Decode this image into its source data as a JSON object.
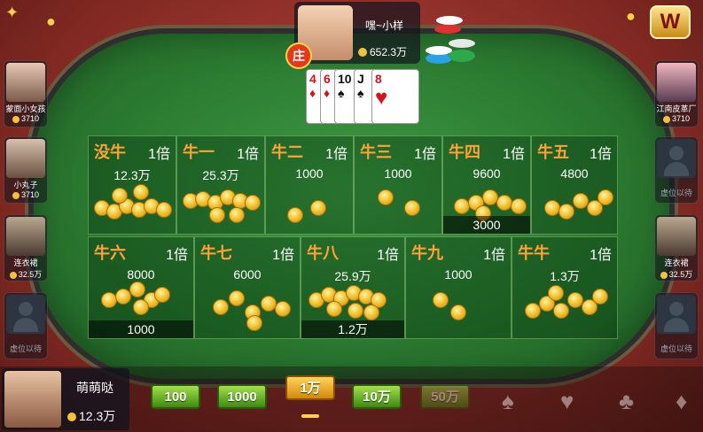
{
  "banker": {
    "name": "嘿~小样",
    "money": "652.3万",
    "badge": "庄"
  },
  "logo": "W",
  "cards": [
    {
      "rank": "4",
      "suit": "♦",
      "color": "red"
    },
    {
      "rank": "6",
      "suit": "♦",
      "color": "red"
    },
    {
      "rank": "10",
      "suit": "♠",
      "color": "black"
    },
    {
      "rank": "J",
      "suit": "♠",
      "color": "black"
    },
    {
      "rank": "8",
      "suit": "♥",
      "color": "red"
    }
  ],
  "left_seats": [
    {
      "name": "蒙面小女孩",
      "money": "3710"
    },
    {
      "name": "小丸子",
      "money": "3710"
    },
    {
      "name": "连衣裙",
      "money": "32.5万"
    },
    {
      "name": "虚位以待",
      "money": ""
    }
  ],
  "right_seats": [
    {
      "name": "江南皮革厂",
      "money": "3710"
    },
    {
      "name": "虚位以待",
      "money": ""
    },
    {
      "name": "连衣裙",
      "money": "32.5万"
    },
    {
      "name": "虚位以待",
      "money": ""
    }
  ],
  "bet_row1": [
    {
      "label": "没牛",
      "mult": "1倍",
      "amount": "12.3万",
      "mine": ""
    },
    {
      "label": "牛一",
      "mult": "1倍",
      "amount": "25.3万",
      "mine": ""
    },
    {
      "label": "牛二",
      "mult": "1倍",
      "amount": "1000",
      "mine": ""
    },
    {
      "label": "牛三",
      "mult": "1倍",
      "amount": "1000",
      "mine": ""
    },
    {
      "label": "牛四",
      "mult": "1倍",
      "amount": "9600",
      "mine": "3000"
    },
    {
      "label": "牛五",
      "mult": "1倍",
      "amount": "4800",
      "mine": ""
    }
  ],
  "bet_row2": [
    {
      "label": "牛六",
      "mult": "1倍",
      "amount": "8000",
      "mine": "1000"
    },
    {
      "label": "牛七",
      "mult": "1倍",
      "amount": "6000",
      "mine": ""
    },
    {
      "label": "牛八",
      "mult": "1倍",
      "amount": "25.9万",
      "mine": "1.2万"
    },
    {
      "label": "牛九",
      "mult": "1倍",
      "amount": "1000",
      "mine": ""
    },
    {
      "label": "牛牛",
      "mult": "1倍",
      "amount": "1.3万",
      "mine": ""
    }
  ],
  "me": {
    "name": "萌萌哒",
    "money": "12.3万"
  },
  "chip_buttons": [
    "100",
    "1000",
    "1万",
    "10万",
    "50万"
  ],
  "selected_chip": "1万",
  "suits": [
    "♠",
    "♥",
    "♣",
    "♦"
  ]
}
